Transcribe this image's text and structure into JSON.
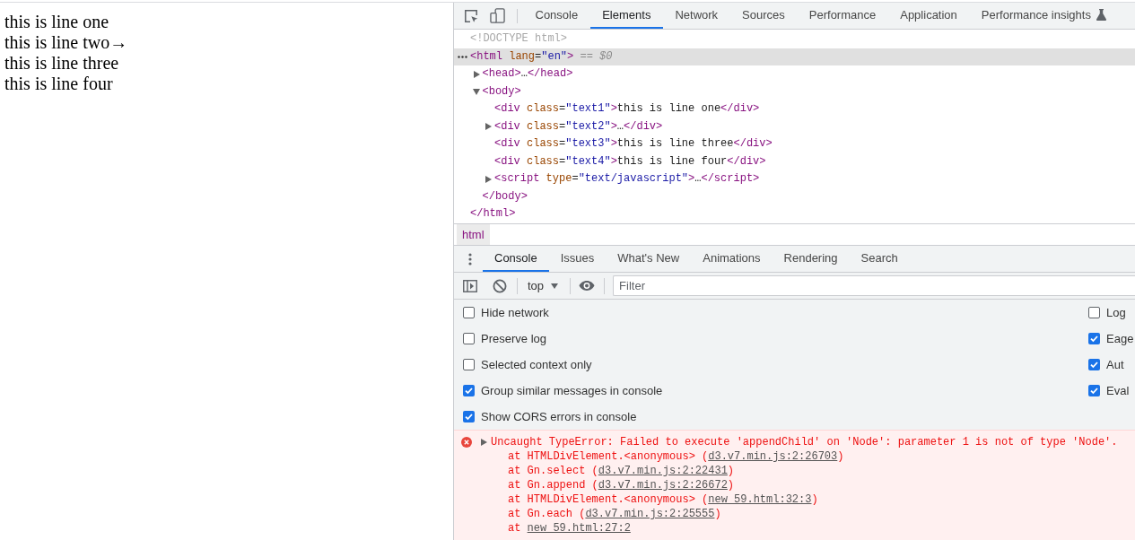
{
  "page_lines": [
    "this is line one",
    "this is line two→",
    "this is line three",
    "this is line four"
  ],
  "devtools": {
    "main_tabs": [
      {
        "label": "Console",
        "selected": false,
        "experimental": false
      },
      {
        "label": "Elements",
        "selected": true,
        "experimental": false
      },
      {
        "label": "Network",
        "selected": false,
        "experimental": false
      },
      {
        "label": "Sources",
        "selected": false,
        "experimental": false
      },
      {
        "label": "Performance",
        "selected": false,
        "experimental": false
      },
      {
        "label": "Application",
        "selected": false,
        "experimental": false
      },
      {
        "label": "Performance insights",
        "selected": false,
        "experimental": true
      }
    ],
    "elements_tree": [
      {
        "selected": false,
        "tokens": [
          {
            "kind": "doctype",
            "text": "<!DOCTYPE html>"
          }
        ]
      },
      {
        "selected": true,
        "expanded": true,
        "tokens": [
          {
            "kind": "tag",
            "text": "<html"
          },
          {
            "kind": "attr",
            "text": " lang"
          },
          {
            "kind": "punct",
            "text": "="
          },
          {
            "kind": "value",
            "text": "\"en\""
          },
          {
            "kind": "tag",
            "text": ">"
          },
          {
            "kind": "note",
            "text": " == $0"
          }
        ],
        "children": [
          {
            "selected": false,
            "expanded": false,
            "tokens": [
              {
                "kind": "tag",
                "text": "<head>"
              },
              {
                "kind": "text",
                "text": "…"
              },
              {
                "kind": "tag",
                "text": "</head>"
              }
            ]
          },
          {
            "selected": false,
            "expanded": true,
            "tokens": [
              {
                "kind": "tag",
                "text": "<body>"
              }
            ],
            "children": [
              {
                "selected": false,
                "tokens": [
                  {
                    "kind": "tag",
                    "text": "<div"
                  },
                  {
                    "kind": "attr",
                    "text": " class"
                  },
                  {
                    "kind": "punct",
                    "text": "="
                  },
                  {
                    "kind": "value",
                    "text": "\"text1\""
                  },
                  {
                    "kind": "tag",
                    "text": ">"
                  },
                  {
                    "kind": "text",
                    "text": "this is line one"
                  },
                  {
                    "kind": "tag",
                    "text": "</div>"
                  }
                ]
              },
              {
                "selected": false,
                "expanded": false,
                "tokens": [
                  {
                    "kind": "tag",
                    "text": "<div"
                  },
                  {
                    "kind": "attr",
                    "text": " class"
                  },
                  {
                    "kind": "punct",
                    "text": "="
                  },
                  {
                    "kind": "value",
                    "text": "\"text2\""
                  },
                  {
                    "kind": "tag",
                    "text": ">"
                  },
                  {
                    "kind": "text",
                    "text": "…"
                  },
                  {
                    "kind": "tag",
                    "text": "</div>"
                  }
                ]
              },
              {
                "selected": false,
                "tokens": [
                  {
                    "kind": "tag",
                    "text": "<div"
                  },
                  {
                    "kind": "attr",
                    "text": " class"
                  },
                  {
                    "kind": "punct",
                    "text": "="
                  },
                  {
                    "kind": "value",
                    "text": "\"text3\""
                  },
                  {
                    "kind": "tag",
                    "text": ">"
                  },
                  {
                    "kind": "text",
                    "text": "this is line three"
                  },
                  {
                    "kind": "tag",
                    "text": "</div>"
                  }
                ]
              },
              {
                "selected": false,
                "tokens": [
                  {
                    "kind": "tag",
                    "text": "<div"
                  },
                  {
                    "kind": "attr",
                    "text": " class"
                  },
                  {
                    "kind": "punct",
                    "text": "="
                  },
                  {
                    "kind": "value",
                    "text": "\"text4\""
                  },
                  {
                    "kind": "tag",
                    "text": ">"
                  },
                  {
                    "kind": "text",
                    "text": "this is line four"
                  },
                  {
                    "kind": "tag",
                    "text": "</div>"
                  }
                ]
              },
              {
                "selected": false,
                "expanded": false,
                "tokens": [
                  {
                    "kind": "tag",
                    "text": "<script"
                  },
                  {
                    "kind": "attr",
                    "text": " type"
                  },
                  {
                    "kind": "punct",
                    "text": "="
                  },
                  {
                    "kind": "value",
                    "text": "\"text/javascript\""
                  },
                  {
                    "kind": "tag",
                    "text": ">"
                  },
                  {
                    "kind": "text",
                    "text": "…"
                  },
                  {
                    "kind": "tag",
                    "text": "</script>"
                  }
                ]
              }
            ],
            "closing": [
              {
                "kind": "tag",
                "text": "</body>"
              }
            ]
          }
        ],
        "closing": [
          {
            "kind": "tag",
            "text": "</html>"
          }
        ]
      }
    ],
    "breadcrumbs": [
      {
        "label": "html",
        "selected": true
      }
    ],
    "drawer_tabs": [
      {
        "label": "Console",
        "selected": true
      },
      {
        "label": "Issues",
        "selected": false
      },
      {
        "label": "What's New",
        "selected": false
      },
      {
        "label": "Animations",
        "selected": false
      },
      {
        "label": "Rendering",
        "selected": false
      },
      {
        "label": "Search",
        "selected": false
      }
    ],
    "console_toolbar": {
      "context": "top",
      "filter": {
        "placeholder": "Filter"
      }
    },
    "console_settings": {
      "left": [
        {
          "label": "Hide network",
          "checked": false
        },
        {
          "label": "Preserve log",
          "checked": false
        },
        {
          "label": "Selected context only",
          "checked": false
        },
        {
          "label": "Group similar messages in console",
          "checked": true
        },
        {
          "label": "Show CORS errors in console",
          "checked": true
        }
      ],
      "right": [
        {
          "label": "Log",
          "checked": false
        },
        {
          "label": "Eage",
          "checked": true
        },
        {
          "label": "Aut",
          "checked": true
        },
        {
          "label": "Eval",
          "checked": true
        }
      ]
    },
    "console_messages": [
      {
        "kind": "error",
        "expanded": false,
        "message": "Uncaught TypeError: Failed to execute 'appendChild' on 'Node': parameter 1 is not of type 'Node'.",
        "stack": [
          {
            "text": "at HTMLDivElement.<anonymous> (",
            "link": "d3.v7.min.js:2:26703",
            "after": ")"
          },
          {
            "text": "at Gn.select (",
            "link": "d3.v7.min.js:2:22431",
            "after": ")"
          },
          {
            "text": "at Gn.append (",
            "link": "d3.v7.min.js:2:26672",
            "after": ")"
          },
          {
            "text": "at HTMLDivElement.<anonymous> (",
            "link": "new 59.html:32:3",
            "after": ")"
          },
          {
            "text": "at Gn.each (",
            "link": "d3.v7.min.js:2:25555",
            "after": ")"
          },
          {
            "text": "at ",
            "link": "new 59.html:27:2"
          }
        ]
      }
    ]
  }
}
